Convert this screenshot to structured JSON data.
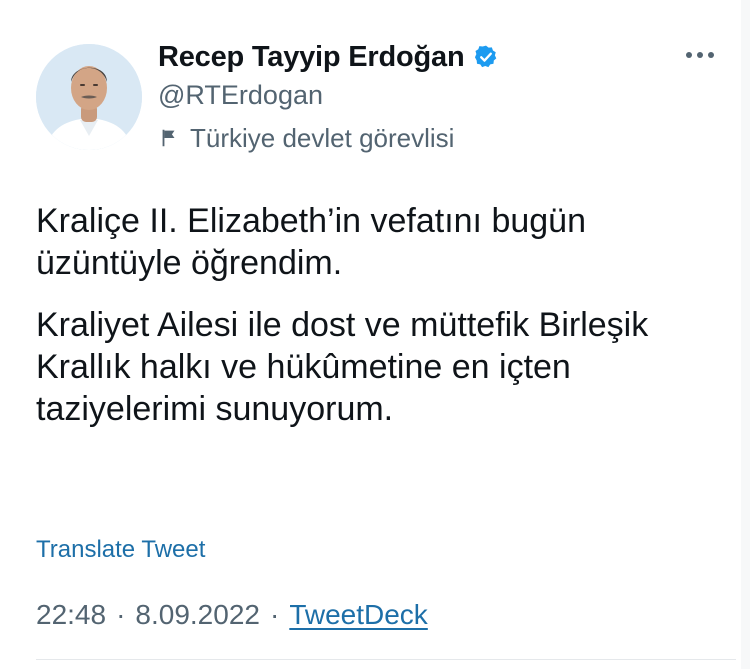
{
  "author": {
    "display_name": "Recep Tayyip Erdoğan",
    "handle": "@RTErdogan",
    "verified": true,
    "account_label": "Türkiye devlet görevlisi",
    "avatar_icon": "profile-photo",
    "label_icon": "flag-icon"
  },
  "tweet": {
    "paragraphs": [
      "Kraliçe II. Elizabeth’in vefatını bugün üzüntüyle öğrendim.",
      "Kraliyet Ailesi ile dost ve müttefik Birleşik Krallık halkı ve hükûmetine en içten taziyelerimi sunuyorum."
    ],
    "translate_label": "Translate Tweet",
    "time": "22:48",
    "date": "8.09.2022",
    "separator": "·",
    "source": "TweetDeck"
  },
  "colors": {
    "verified_badge": "#1d9bf0",
    "link": "#1d6fa8",
    "secondary_text": "#536471",
    "primary_text": "#0f1419"
  }
}
